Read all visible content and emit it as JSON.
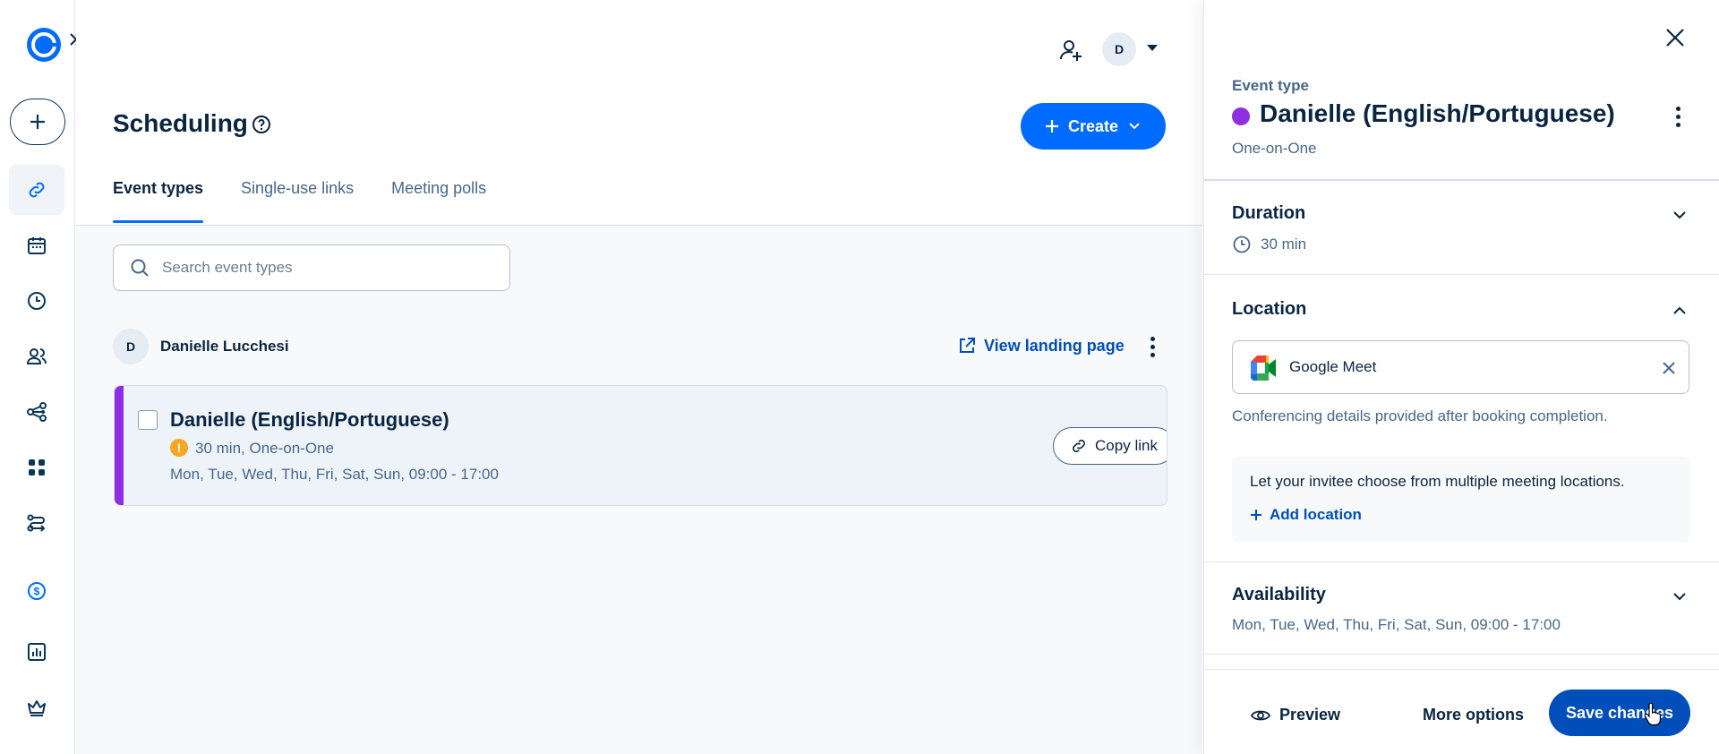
{
  "rail": {
    "items": [
      {
        "name": "link-icon",
        "active": true
      },
      {
        "name": "calendar-icon"
      },
      {
        "name": "clock-icon"
      },
      {
        "name": "people-icon"
      },
      {
        "name": "workflow-icon"
      },
      {
        "name": "apps-icon"
      },
      {
        "name": "routing-icon"
      },
      {
        "name": "billing-icon"
      },
      {
        "name": "analytics-icon"
      },
      {
        "name": "admin-crown-icon"
      }
    ]
  },
  "header": {
    "avatar_initial": "D",
    "page_title": "Scheduling",
    "create_label": "Create"
  },
  "tabs": [
    {
      "label": "Event types",
      "active": true
    },
    {
      "label": "Single-use links"
    },
    {
      "label": "Meeting polls"
    }
  ],
  "search": {
    "placeholder": "Search event types"
  },
  "owner": {
    "initial": "D",
    "name": "Danielle Lucchesi",
    "landing_label": "View landing page"
  },
  "event": {
    "title": "Danielle (English/Portuguese)",
    "warning_glyph": "!",
    "meta": "30 min, One-on-One",
    "schedule": "Mon, Tue, Wed, Thu, Fri, Sat, Sun, 09:00 - 17:00",
    "copy_label": "Copy link",
    "color": "#8e2de2"
  },
  "panel": {
    "label": "Event type",
    "title": "Danielle (English/Portuguese)",
    "subtitle": "One-on-One",
    "duration": {
      "title": "Duration",
      "value": "30 min"
    },
    "location": {
      "title": "Location",
      "provider": "Google Meet",
      "note": "Conferencing details provided after booking completion.",
      "multi_text": "Let your invitee choose from multiple meeting locations.",
      "add_label": "Add location"
    },
    "availability": {
      "title": "Availability",
      "value": "Mon, Tue, Wed, Thu, Fri, Sat, Sun, 09:00 - 17:00"
    },
    "footer": {
      "preview_label": "Preview",
      "more_label": "More options",
      "save_label": "Save changes"
    }
  },
  "colors": {
    "brand_blue": "#006bff",
    "dark_blue": "#004eba",
    "text": "#0a2540",
    "muted": "#476788"
  }
}
